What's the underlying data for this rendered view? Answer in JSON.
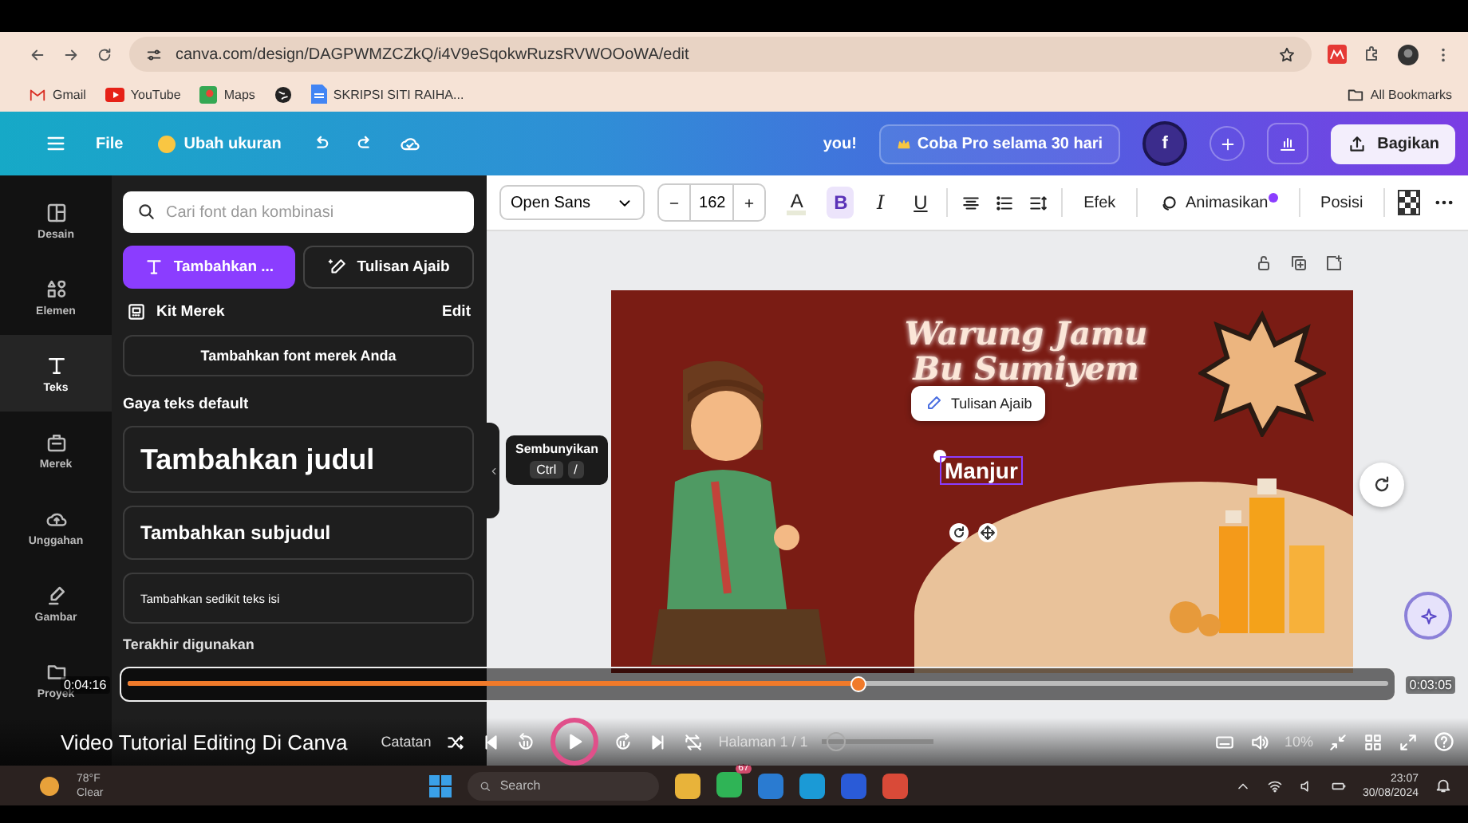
{
  "browser": {
    "url": "canva.com/design/DAGPWMZCZkQ/i4V9eSqokwRuzsRVWOOoWA/edit",
    "bookmarks": [
      {
        "kind": "mail",
        "label": "Gmail"
      },
      {
        "kind": "video",
        "label": "YouTube"
      },
      {
        "kind": "map",
        "label": "Maps"
      },
      {
        "kind": "globe"
      },
      {
        "kind": "doc",
        "label": "SKRIPSI SITI RAIHA..."
      }
    ],
    "all_bookmarks": "All Bookmarks"
  },
  "header": {
    "file": "File",
    "resize": "Ubah ukuran",
    "greeting": "you!",
    "pro": "Coba Pro selama 30 hari",
    "avatar": "f",
    "share": "Bagikan"
  },
  "rail": [
    {
      "kind": "layout",
      "label": "Desain",
      "selected": false
    },
    {
      "kind": "shapes",
      "label": "Elemen",
      "selected": false
    },
    {
      "kind": "text",
      "label": "Teks",
      "selected": true
    },
    {
      "kind": "brand",
      "label": "Merek",
      "selected": false
    },
    {
      "kind": "upload",
      "label": "Unggahan",
      "selected": false
    },
    {
      "kind": "draw",
      "label": "Gambar",
      "selected": false
    },
    {
      "kind": "folder",
      "label": "Proyek",
      "selected": false
    }
  ],
  "panel": {
    "search_placeholder": "Cari font dan kombinasi",
    "tabs": [
      {
        "label": "Tambahkan ...",
        "selected": true
      },
      {
        "label": "Tulisan Ajaib",
        "selected": false
      }
    ],
    "brand_kit": "Kit Merek",
    "edit": "Edit",
    "brand_font": "Tambahkan font merek Anda",
    "section": "Gaya teks default",
    "styles": [
      {
        "kind": "heading",
        "label": "Tambahkan judul"
      },
      {
        "kind": "subheading",
        "label": "Tambahkan subjudul"
      },
      {
        "kind": "body",
        "label": "Tambahkan sedikit teks isi"
      }
    ],
    "recent": "Terakhir digunakan"
  },
  "tooltip": {
    "title": "Sembunyikan",
    "keys": [
      "Ctrl",
      "/"
    ]
  },
  "toolbar": {
    "font": "Open Sans",
    "size": "162",
    "color_letter": "A",
    "format": [
      {
        "kind": "bold",
        "label": "B",
        "selected": true
      },
      {
        "kind": "italic",
        "label": "I",
        "selected": false
      },
      {
        "kind": "underline",
        "label": "U",
        "selected": false
      }
    ],
    "effects": "Efek",
    "animate": "Animasikan",
    "position": "Posisi"
  },
  "design": {
    "title_lines": [
      "Warung Jamu",
      "Bu Sumiyem"
    ],
    "magic_chip": "Tulisan Ajaib",
    "selected_text": "Manjur"
  },
  "footer": {
    "notes": "Catatan",
    "page": "Halaman 1 / 1",
    "zoom": "10%",
    "zoom_slider": {
      "level": 0.05
    }
  },
  "video": {
    "title": "Video Tutorial Editing Di Canva",
    "elapsed": "0:04:16",
    "remaining": "0:03:05",
    "level": 0.58
  },
  "taskbar": {
    "temperature": "78°F",
    "weather": "Clear",
    "search_placeholder": "Search",
    "badge": "67",
    "time": "23:07",
    "date": "30/08/2024"
  }
}
